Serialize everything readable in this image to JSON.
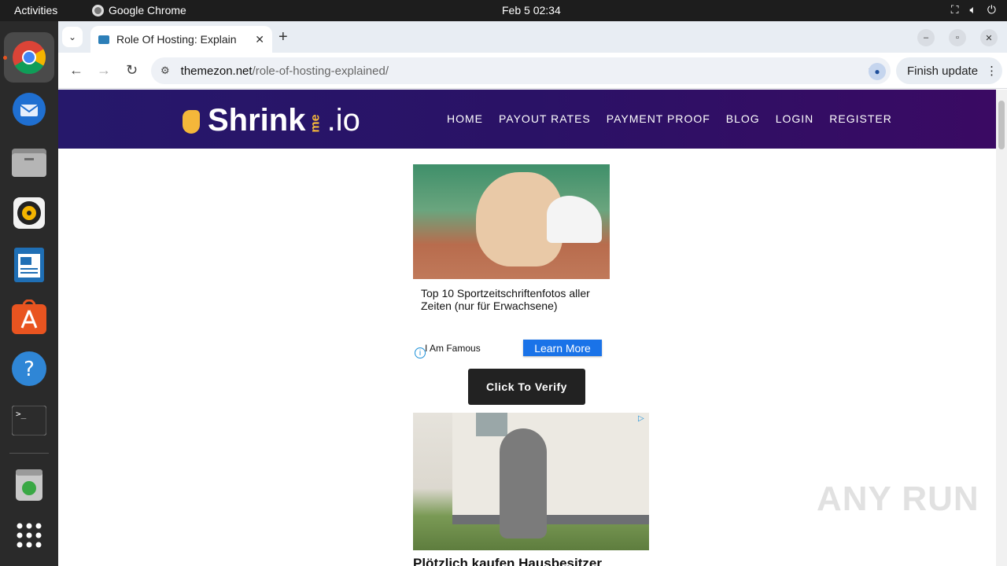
{
  "system_bar": {
    "activities": "Activities",
    "app_name": "Google Chrome",
    "clock": "Feb 5  02:34"
  },
  "dock": {
    "apps": [
      "chrome-icon",
      "thunderbird-icon",
      "files-icon",
      "rhythmbox-icon",
      "writer-icon",
      "app-center-icon",
      "help-icon",
      "terminal-icon",
      "trash-icon",
      "app-grid-icon"
    ]
  },
  "browser": {
    "tab_title": "Role Of Hosting: Explain",
    "url_host": "themezon.net",
    "url_path": "/role-of-hosting-explained/",
    "finish_update": "Finish update"
  },
  "site": {
    "logo_main": "Shrink",
    "logo_me": "me",
    "logo_tld": ".io",
    "menu": [
      "HOME",
      "PAYOUT RATES",
      "PAYMENT PROOF",
      "BLOG",
      "LOGIN",
      "REGISTER"
    ]
  },
  "ad1": {
    "caption": "Top 10 Sportzeitschriftenfotos aller Zeiten (nur für Erwachsene)",
    "brand": "I Am Famous",
    "cta": "Learn More"
  },
  "verify_button": "Click To Verify",
  "ad2": {
    "headline": "Plötzlich kaufen Hausbesitzer"
  },
  "watermark": "ANY RUN"
}
